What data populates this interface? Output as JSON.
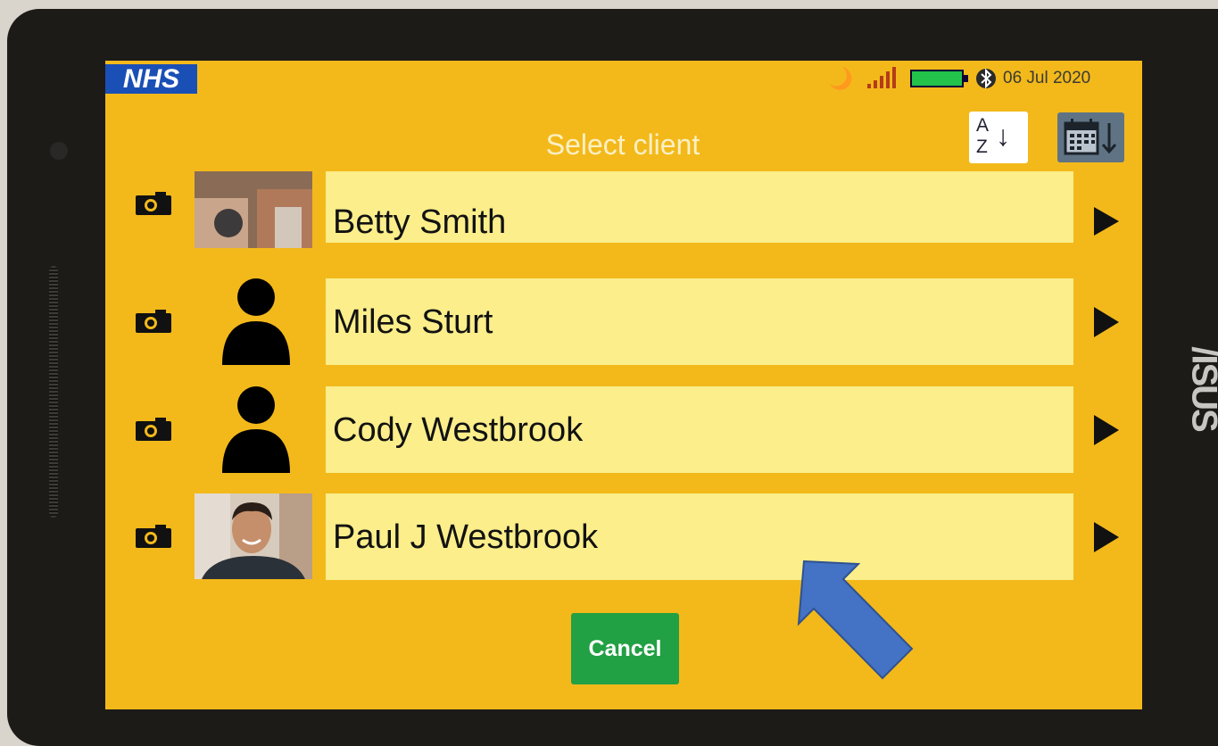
{
  "device": {
    "brand": "/ISUS"
  },
  "statusbar": {
    "logo": "NHS",
    "date": "06 Jul 2020",
    "icons": [
      "moon-icon",
      "signal-icon",
      "battery-icon",
      "bluetooth-icon"
    ]
  },
  "header": {
    "title": "Select client",
    "sort_alpha": {
      "top": "A",
      "bottom": "Z",
      "arrow": "↓",
      "icon": "sort-alphabetical-icon"
    },
    "sort_date_icon": "sort-by-date-icon"
  },
  "clients": [
    {
      "name": "Betty Smith",
      "avatar": "photo"
    },
    {
      "name": "Miles Sturt",
      "avatar": "placeholder"
    },
    {
      "name": "Cody Westbrook",
      "avatar": "placeholder"
    },
    {
      "name": "Paul J Westbrook",
      "avatar": "photo"
    }
  ],
  "cancel_label": "Cancel",
  "colors": {
    "screen_bg": "#f3b91b",
    "row_bg": "#fbee8b",
    "nhs_blue": "#1a4fb6",
    "cancel_green": "#22a044",
    "pointer_blue": "#4472c4"
  }
}
